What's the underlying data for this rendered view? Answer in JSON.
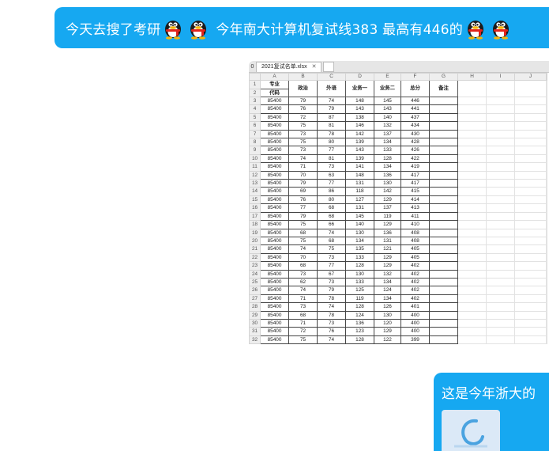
{
  "message1": {
    "segments": [
      "今天去搜了考研",
      "今年南大计算机复试线383 最高有446的"
    ],
    "emoji_name": "qq-penguin-emoji"
  },
  "message2": {
    "text": "这是今年浙大的",
    "attachment_icon": "image-thumbnail"
  },
  "spreadsheet": {
    "tab_index": "0",
    "file_name": "2021复试名单.xlsx",
    "columns": [
      "A",
      "B",
      "C",
      "D",
      "E",
      "F",
      "G",
      "H",
      "I",
      "J"
    ],
    "header_a_line1": "专业",
    "header_a_line2": "代码",
    "headers": [
      "政治",
      "外语",
      "业务一",
      "业务二",
      "总分",
      "备注"
    ],
    "rows": [
      [
        "85400",
        "79",
        "74",
        "148",
        "145",
        "446"
      ],
      [
        "85400",
        "76",
        "79",
        "143",
        "143",
        "441"
      ],
      [
        "85400",
        "72",
        "87",
        "138",
        "140",
        "437"
      ],
      [
        "85400",
        "75",
        "81",
        "146",
        "132",
        "434"
      ],
      [
        "85400",
        "73",
        "78",
        "142",
        "137",
        "430"
      ],
      [
        "85400",
        "75",
        "80",
        "139",
        "134",
        "428"
      ],
      [
        "85400",
        "73",
        "77",
        "143",
        "133",
        "426"
      ],
      [
        "85400",
        "74",
        "81",
        "139",
        "128",
        "422"
      ],
      [
        "85400",
        "71",
        "73",
        "141",
        "134",
        "419"
      ],
      [
        "85400",
        "70",
        "63",
        "148",
        "136",
        "417"
      ],
      [
        "85400",
        "79",
        "77",
        "131",
        "130",
        "417"
      ],
      [
        "85400",
        "69",
        "86",
        "118",
        "142",
        "415"
      ],
      [
        "85400",
        "76",
        "80",
        "127",
        "129",
        "414"
      ],
      [
        "85400",
        "77",
        "68",
        "131",
        "137",
        "413"
      ],
      [
        "85400",
        "79",
        "68",
        "145",
        "119",
        "411"
      ],
      [
        "85400",
        "75",
        "66",
        "140",
        "129",
        "410"
      ],
      [
        "85400",
        "68",
        "74",
        "130",
        "136",
        "408"
      ],
      [
        "85400",
        "75",
        "68",
        "134",
        "131",
        "408"
      ],
      [
        "85400",
        "74",
        "75",
        "135",
        "121",
        "405"
      ],
      [
        "85400",
        "70",
        "73",
        "133",
        "129",
        "405"
      ],
      [
        "85400",
        "68",
        "77",
        "128",
        "129",
        "402"
      ],
      [
        "85400",
        "73",
        "67",
        "130",
        "132",
        "402"
      ],
      [
        "85400",
        "62",
        "73",
        "133",
        "134",
        "402"
      ],
      [
        "85400",
        "74",
        "79",
        "125",
        "124",
        "402"
      ],
      [
        "85400",
        "71",
        "78",
        "119",
        "134",
        "402"
      ],
      [
        "85400",
        "73",
        "74",
        "128",
        "126",
        "401"
      ],
      [
        "85400",
        "68",
        "78",
        "124",
        "130",
        "400"
      ],
      [
        "85400",
        "71",
        "73",
        "136",
        "120",
        "400"
      ],
      [
        "85400",
        "72",
        "76",
        "123",
        "129",
        "400"
      ],
      [
        "85400",
        "75",
        "74",
        "128",
        "122",
        "399"
      ]
    ]
  },
  "colors": {
    "bubble": "#16a8f1",
    "bubble_text": "#ffffff"
  }
}
